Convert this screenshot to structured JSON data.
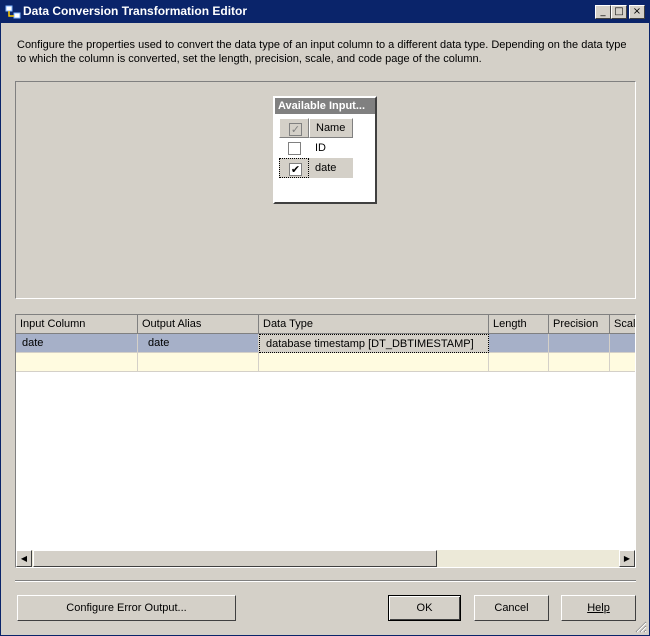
{
  "window": {
    "title": "Data Conversion Transformation Editor",
    "controls": {
      "minimize": "_",
      "maximize": "□",
      "close": "×"
    }
  },
  "description": "Configure the properties used to convert the data type of an input column to a different data type. Depending on the data type to which the column is converted, set the length, precision, scale, and code page of the column.",
  "available_inputs": {
    "title": "Available Input...",
    "header_name": "Name",
    "columns": [
      {
        "name": "ID",
        "checked": false
      },
      {
        "name": "date",
        "checked": true
      }
    ]
  },
  "grid": {
    "headers": [
      "Input Column",
      "Output Alias",
      "Data Type",
      "Length",
      "Precision",
      "Scal"
    ],
    "rows": [
      {
        "input_column": "date",
        "output_alias": "date",
        "data_type": "database timestamp [DT_DBTIMESTAMP]",
        "length": "",
        "precision": "",
        "scale": ""
      }
    ]
  },
  "buttons": {
    "configure_error_output": "Configure Error Output...",
    "ok": "OK",
    "cancel": "Cancel",
    "help": "Help"
  },
  "colors": {
    "titlebar": "#0a246a",
    "selected_row": "#a6b0c8",
    "new_row": "#fffbe0",
    "dialog_bg": "#d4d0c8"
  },
  "icons": {
    "app": "data-flow-icon",
    "scroll_left": "arrow-left-icon",
    "scroll_right": "arrow-right-icon",
    "resize": "resize-grip-icon"
  }
}
